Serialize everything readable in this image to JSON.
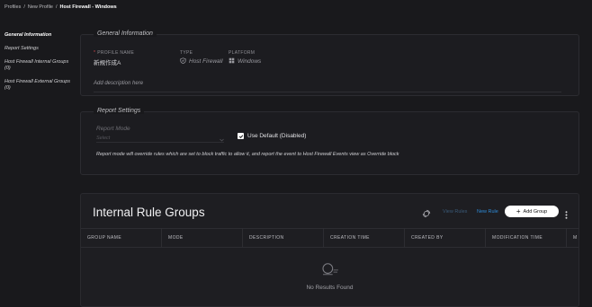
{
  "breadcrumb": {
    "profiles": "Profiles",
    "sep1": "/",
    "new_profile": "New Profile",
    "sep2": "/",
    "current": "Host Firewall - Windows"
  },
  "sidebar": {
    "items": [
      {
        "label": "General Information"
      },
      {
        "label": "Report Settings"
      },
      {
        "label": "Host Firewall Internal Groups",
        "count": "(0)"
      },
      {
        "label": "Host Firewall External Groups",
        "count": "(0)"
      }
    ]
  },
  "general": {
    "title": "General Information",
    "required_mark": "*",
    "profile_name_label": "PROFILE NAME",
    "profile_name_value": "新規作成A",
    "type_label": "TYPE",
    "type_value": "Host Firewall",
    "type_icon": "shield-check-icon",
    "platform_label": "PLATFORM",
    "platform_value": "Windows",
    "platform_icon": "windows-icon",
    "description_placeholder": "Add description here"
  },
  "report": {
    "title": "Report Settings",
    "mode_label": "Report Mode",
    "mode_placeholder": "Select",
    "use_default_label": "Use Default (Disabled)",
    "use_default_checked": true,
    "note": "Report mode will override rules which are set to block traffic to allow it, and report the event to Host Firewall Events view as Override block"
  },
  "rules": {
    "title": "Internal Rule Groups",
    "view_rules": "View Rules",
    "new_rule": "New Rule",
    "add_group": "Add Group",
    "columns": [
      "GROUP NAME",
      "MODE",
      "DESCRIPTION",
      "CREATION TIME",
      "CREATED BY",
      "MODIFICATION TIME",
      "M"
    ],
    "empty_text": "No Results Found"
  },
  "colors": {
    "link": "#2e8bd8",
    "disabled_link": "#3a5a78",
    "required": "#e0484d",
    "background": "#19191c"
  }
}
